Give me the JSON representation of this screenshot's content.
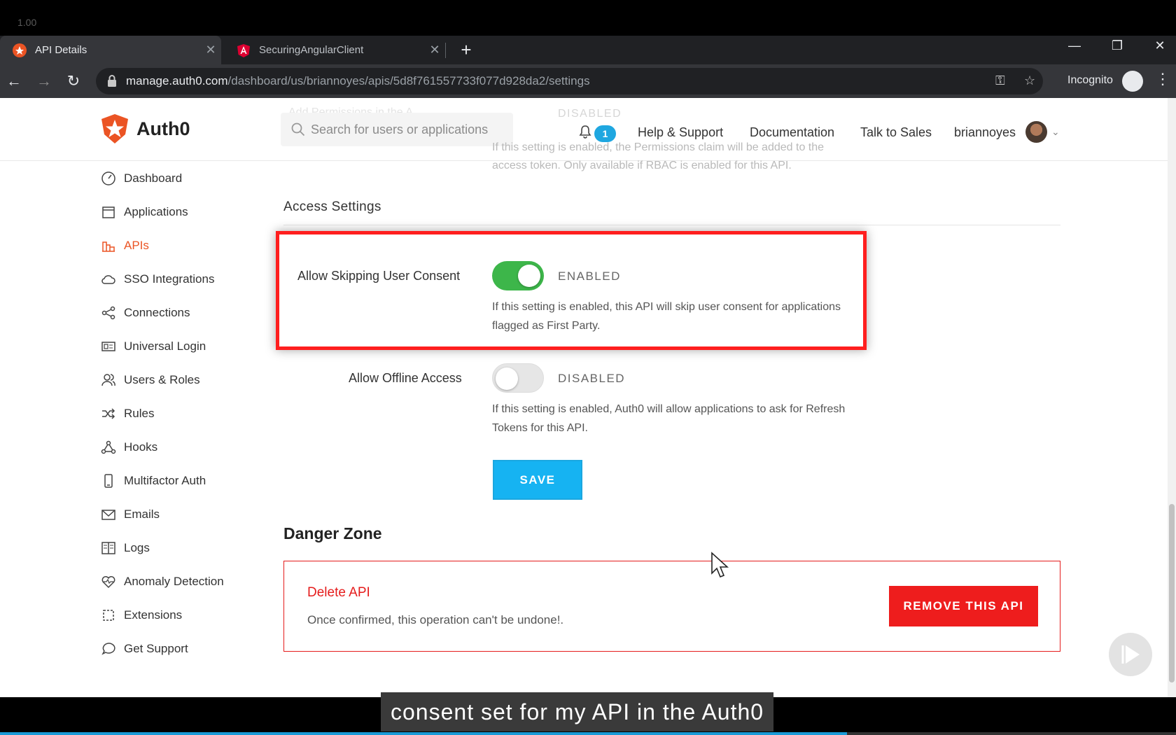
{
  "video": {
    "speed": "1.00",
    "caption": "consent set for my API in the Auth0",
    "progress": 0.72
  },
  "browser": {
    "tabs": [
      {
        "title": "API Details",
        "active": true
      },
      {
        "title": "SecuringAngularClient",
        "active": false
      }
    ],
    "url_host": "manage.auth0.com",
    "url_path": "/dashboard/us/briannoyes/apis/5d8f761557733f077d928da2/settings",
    "mode_label": "Incognito"
  },
  "header": {
    "brand": "Auth0",
    "search_placeholder": "Search for users or applications",
    "notification_count": "1",
    "links": [
      "Help & Support",
      "Documentation",
      "Talk to Sales"
    ],
    "username": "briannoyes",
    "ghost_label": "Add Permissions in the A",
    "ghost_state": "DISABLED"
  },
  "sidebar": {
    "items": [
      {
        "label": "Dashboard",
        "icon": "dashboard-icon",
        "active": false
      },
      {
        "label": "Applications",
        "icon": "applications-icon",
        "active": false
      },
      {
        "label": "APIs",
        "icon": "apis-icon",
        "active": true
      },
      {
        "label": "SSO Integrations",
        "icon": "cloud-icon",
        "active": false
      },
      {
        "label": "Connections",
        "icon": "share-icon",
        "active": false
      },
      {
        "label": "Universal Login",
        "icon": "login-icon",
        "active": false
      },
      {
        "label": "Users & Roles",
        "icon": "users-icon",
        "active": false
      },
      {
        "label": "Rules",
        "icon": "shuffle-icon",
        "active": false
      },
      {
        "label": "Hooks",
        "icon": "hooks-icon",
        "active": false
      },
      {
        "label": "Multifactor Auth",
        "icon": "phone-icon",
        "active": false
      },
      {
        "label": "Emails",
        "icon": "mail-icon",
        "active": false
      },
      {
        "label": "Logs",
        "icon": "book-icon",
        "active": false
      },
      {
        "label": "Anomaly Detection",
        "icon": "heart-icon",
        "active": false
      },
      {
        "label": "Extensions",
        "icon": "puzzle-icon",
        "active": false
      },
      {
        "label": "Get Support",
        "icon": "chat-icon",
        "active": false
      }
    ]
  },
  "main": {
    "faded_help": "If this setting is enabled, the Permissions claim will be added to the access token. Only available if RBAC is enabled for this API.",
    "section_title": "Access Settings",
    "skip_consent": {
      "label": "Allow Skipping User Consent",
      "state": "ENABLED",
      "enabled": true,
      "help": "If this setting is enabled, this API will skip user consent for applications flagged as First Party."
    },
    "offline_access": {
      "label": "Allow Offline Access",
      "state": "DISABLED",
      "enabled": false,
      "help": "If this setting is enabled, Auth0 will allow applications to ask for Refresh Tokens for this API."
    },
    "save_label": "SAVE",
    "danger": {
      "title": "Danger Zone",
      "heading": "Delete API",
      "description": "Once confirmed, this operation can't be undone!.",
      "button": "REMOVE THIS API"
    }
  },
  "colors": {
    "accent": "#eb5424",
    "toggle_on": "#3db64a",
    "save": "#16b3f2",
    "danger": "#e51c1c",
    "highlight": "#ff1f1f"
  }
}
